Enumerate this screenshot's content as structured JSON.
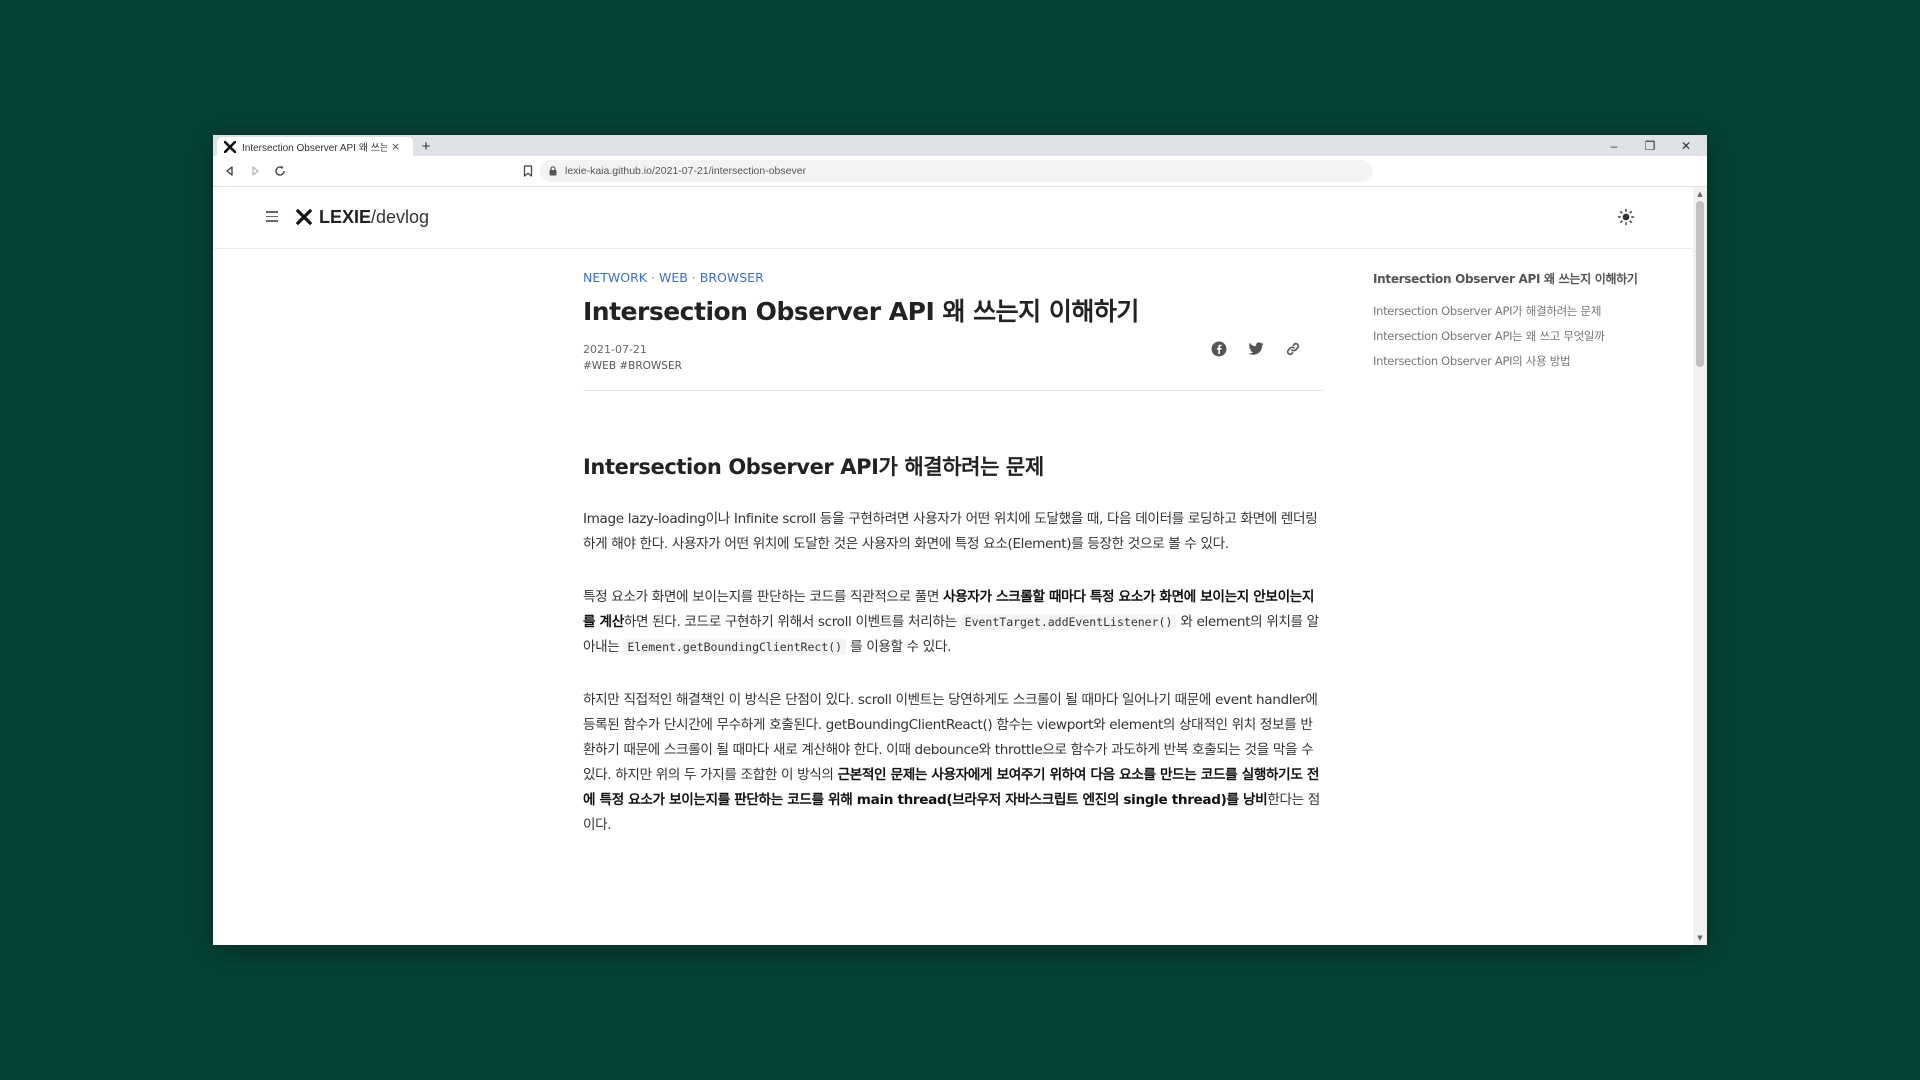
{
  "browser": {
    "tab_title": "Intersection Observer API 왜 쓰는",
    "tab_close": "×",
    "new_tab": "+",
    "url": "lexie-kaia.github.io/2021-07-21/intersection-obsever",
    "controls": {
      "minimize": "–",
      "restore": "❐",
      "close": "✕"
    }
  },
  "site": {
    "brand": "LEXIE",
    "suffix": "/devlog"
  },
  "article": {
    "categories": [
      "NETWORK",
      "WEB",
      "BROWSER"
    ],
    "category_sep": "·",
    "title": "Intersection Observer API 왜 쓰는지 이해하기",
    "date": "2021-07-21",
    "tags": "#WEB #BROWSER",
    "share": [
      "facebook-icon",
      "twitter-icon",
      "link-icon"
    ],
    "section_heading": "Intersection Observer API가 해결하려는 문제",
    "p1": "Image lazy-loading이나 Infinite scroll 등을 구현하려면 사용자가 어떤 위치에 도달했을 때, 다음 데이터를 로딩하고 화면에 렌더링하게 해야 한다. 사용자가 어떤 위치에 도달한 것은 사용자의 화면에 특정 요소(Element)를 등장한 것으로 볼 수 있다.",
    "p2": {
      "a": "특정 요소가 화면에 보이는지를 판단하는 코드를 직관적으로 풀면 ",
      "b": "사용자가 스크롤할 때마다 특정 요소가 화면에 보이는지 안보이는지를 계산",
      "c": "하면 된다. 코드로 구현하기 위해서 scroll 이벤트를 처리하는 ",
      "code1": "EventTarget.addEventListener()",
      "d": " 와 element의 위치를 알아내는 ",
      "code2": "Element.getBoundingClientRect()",
      "e": " 를 이용할 수 있다."
    },
    "p3": {
      "a": "하지만 직접적인 해결책인 이 방식은 단점이 있다. scroll 이벤트는 당연하게도 스크롤이 될 때마다 일어나기 때문에 event handler에 등록된 함수가 단시간에 무수하게 호출된다. getBoundingClientReact() 함수는 viewport와 element의 상대적인 위치 정보를 반환하기 때문에 스크롤이 될 때마다 새로 계산해야 한다. 이때 debounce와 throttle으로 함수가 과도하게 반복 호출되는 것을 막을 수 있다. 하지만 위의 두 가지를 조합한 이 방식의 ",
      "b": "근본적인 문제는 사용자에게 보여주기 위하여 다음 요소를 만드는 코드를 실행하기도 전에 특정 요소가 보이는지를 판단하는 코드를 위해 main thread(브라우저 자바스크립트 엔진의 single thread)를 낭비",
      "c": "한다는 점이다."
    }
  },
  "toc": {
    "title": "Intersection Observer API 왜 쓰는지 이해하기",
    "items": [
      "Intersection Observer API가 해결하려는 문제",
      "Intersection Observer API는 왜 쓰고 무엇일까",
      "Intersection Observer API의 사용 방법"
    ]
  }
}
